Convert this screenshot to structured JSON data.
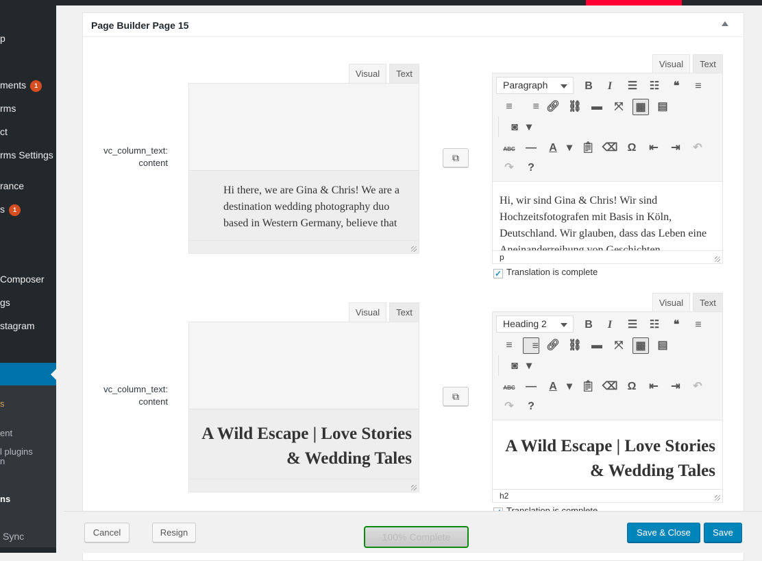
{
  "sidebar": {
    "items": [
      {
        "label": "p"
      },
      {
        "label": "ments",
        "badge": "1"
      },
      {
        "label": "rms"
      },
      {
        "label": "ct"
      },
      {
        "label": "rms Settings"
      },
      {
        "label": "rance"
      },
      {
        "label": "s",
        "badge": "1"
      },
      {
        "label": "Composer"
      },
      {
        "label": "gs"
      },
      {
        "label": "stagram"
      }
    ],
    "submenu": [
      "s",
      "ent",
      "l plugins",
      "n",
      "ns",
      "Sync"
    ]
  },
  "panel": {
    "title": "Page Builder Page 15"
  },
  "rows": [
    {
      "label_line1": "vc_column_text:",
      "label_line2": "content",
      "tabs": [
        "Visual",
        "Text"
      ],
      "original": "Hi there, we are Gina & Chris! We are a destination wedding photography duo based in Western Germany, believe that",
      "translation": "Hi, wir sind Gina & Chris! Wir sind Hochzeitsfotografen mit Basis in Köln, Deutschland. Wir glauben, dass das Leben eine Aneinanderreihung von Geschichten",
      "format": "Paragraph",
      "status_path": "p",
      "complete_label": "Translation is complete",
      "complete": true
    },
    {
      "label_line1": "vc_column_text:",
      "label_line2": "content",
      "tabs": [
        "Visual",
        "Text"
      ],
      "original": "A Wild Escape | Love Stories & Wedding Tales",
      "translation": "A Wild Escape | Love Stories & Wedding Tales",
      "format": "Heading 2",
      "status_path": "h2",
      "complete_label": "Translation is complete",
      "complete": true
    }
  ],
  "toolbar_icons": [
    "bold-icon",
    "italic-icon",
    "bullet-list-icon",
    "numbered-list-icon",
    "blockquote-icon",
    "align-left-icon",
    "align-center-icon",
    "align-right-icon",
    "link-icon",
    "unlink-icon",
    "read-more-icon",
    "fullscreen-icon",
    "toolbar-toggle-icon",
    "form-icon",
    "instagram-icon",
    "dropdown-arrow-icon",
    "strikethrough-icon",
    "horizontal-line-icon",
    "text-color-icon",
    "text-color-dropdown-icon",
    "paste-text-icon",
    "clear-formatting-icon",
    "special-character-icon",
    "outdent-icon",
    "indent-icon",
    "undo-icon",
    "redo-icon",
    "help-icon"
  ],
  "footer": {
    "cancel": "Cancel",
    "resign": "Resign",
    "progress": "100% Complete",
    "progress_value": 100,
    "save_close": "Save & Close",
    "save": "Save"
  },
  "colors": {
    "primary": "#0085ba",
    "sidebar": "#23282d",
    "badge": "#d54e21",
    "progress_border": "#0a8a0a",
    "top_accent": "#ff0033"
  }
}
